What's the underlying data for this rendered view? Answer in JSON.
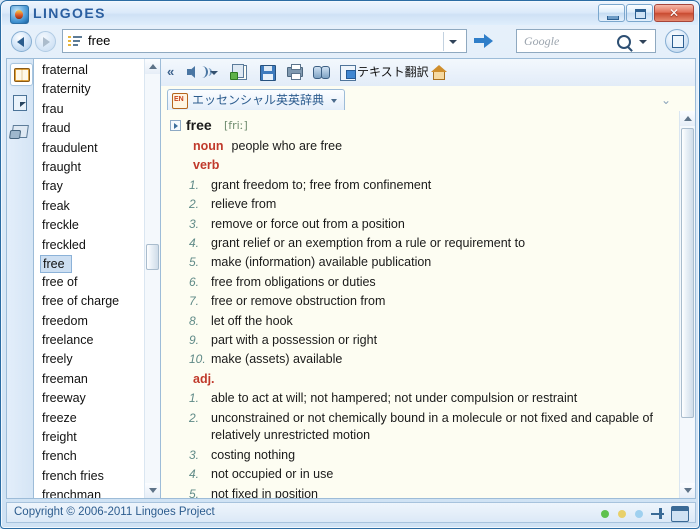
{
  "window": {
    "brand": "LINGOES",
    "logo_icon": "parrot-logo-icon",
    "buttons": {
      "minimize": "minimize-button",
      "maximize": "maximize-button",
      "close_glyph": "✕"
    }
  },
  "searchbar": {
    "back_icon": "back-arrow-icon",
    "forward_icon": "forward-arrow-icon",
    "query_value": "free",
    "list_icon": "word-list-icon",
    "dropdown_icon": "chevron-down-icon",
    "go_icon": "go-arrow-icon",
    "google_placeholder": "Google",
    "google_value": "",
    "search_icon": "magnifier-icon",
    "google_caret_icon": "chevron-down-icon",
    "menu_icon": "app-menu-icon"
  },
  "sidebar": {
    "items": [
      {
        "name": "dictionary-mode",
        "icon": "open-book-icon",
        "selected": true
      },
      {
        "name": "text-capture-mode",
        "icon": "document-cursor-icon",
        "selected": false
      },
      {
        "name": "card-mode",
        "icon": "hand-card-icon",
        "selected": false
      }
    ]
  },
  "wordlist": {
    "items": [
      "fraternal",
      "fraternity",
      "frau",
      "fraud",
      "fraudulent",
      "fraught",
      "fray",
      "freak",
      "freckle",
      "freckled",
      "free",
      "free of",
      "free of charge",
      "freedom",
      "freelance",
      "freely",
      "freeman",
      "freeway",
      "freeze",
      "freight",
      "french",
      "french fries",
      "frenchman"
    ],
    "selected": "free"
  },
  "content_toolbar": {
    "collapse_label": "«",
    "items": [
      {
        "name": "pronounce-button",
        "icon": "speaker-icon",
        "label": ""
      },
      {
        "name": "pronounce-dropdown",
        "icon": "chevron-down-icon",
        "label": ""
      },
      {
        "name": "copy-button",
        "icon": "copy-icon",
        "label": ""
      },
      {
        "name": "save-button",
        "icon": "save-disk-icon",
        "label": ""
      },
      {
        "name": "print-button",
        "icon": "printer-icon",
        "label": ""
      },
      {
        "name": "find-button",
        "icon": "binoculars-icon",
        "label": ""
      },
      {
        "name": "text-translate-button",
        "icon": "translate-icon",
        "label": "テキスト翻訳"
      },
      {
        "name": "home-button",
        "icon": "home-icon",
        "label": ""
      }
    ]
  },
  "dictionary_tab": {
    "label": "エッセンシャル英英辞典",
    "icon": "en-dictionary-icon",
    "caret_icon": "chevron-down-icon",
    "overflow_icon": "chevron-down-icon"
  },
  "entry": {
    "headword": "free",
    "phonetic": "[friː]",
    "expander_icon": "expand-triangle-icon",
    "senses": [
      {
        "pos": "noun",
        "gloss": "people who are free",
        "defs": []
      },
      {
        "pos": "verb",
        "gloss": "",
        "defs": [
          {
            "num": "1.",
            "text": "grant freedom to; free from confinement"
          },
          {
            "num": "2.",
            "text": "relieve from"
          },
          {
            "num": "3.",
            "text": "remove or force out from a position"
          },
          {
            "num": "4.",
            "text": "grant relief or an exemption from a rule or requirement to"
          },
          {
            "num": "5.",
            "text": "make (information) available publication"
          },
          {
            "num": "6.",
            "text": "free from obligations or duties"
          },
          {
            "num": "7.",
            "text": "free or remove obstruction from"
          },
          {
            "num": "8.",
            "text": "let off the hook"
          },
          {
            "num": "9.",
            "text": "part with a possession or right"
          },
          {
            "num": "10.",
            "text": "make (assets) available"
          }
        ]
      },
      {
        "pos": "adj.",
        "gloss": "",
        "defs": [
          {
            "num": "1.",
            "text": "able to act at will; not hampered; not under compulsion or restraint"
          },
          {
            "num": "2.",
            "text": "unconstrained or not chemically bound in a molecule or not fixed and capable of relatively unrestricted motion"
          },
          {
            "num": "3.",
            "text": "costing nothing"
          },
          {
            "num": "4.",
            "text": "not occupied or in use"
          },
          {
            "num": "5.",
            "text": "not fixed in position"
          }
        ]
      }
    ]
  },
  "statusbar": {
    "copyright": "Copyright © 2006-2011 Lingoes Project",
    "dots": [
      {
        "name": "status-dot-green",
        "color": "#5fc14e"
      },
      {
        "name": "status-dot-yellow",
        "color": "#e8d06a"
      },
      {
        "name": "status-dot-blue",
        "color": "#9fd0ef"
      }
    ],
    "pin_icon": "pin-icon",
    "window_icon": "window-mode-icon"
  },
  "colors": {
    "accent": "#2b5fa0",
    "pos_red": "#c0392b",
    "num_teal": "#5f8a87",
    "paper": "#fdfdf2"
  }
}
